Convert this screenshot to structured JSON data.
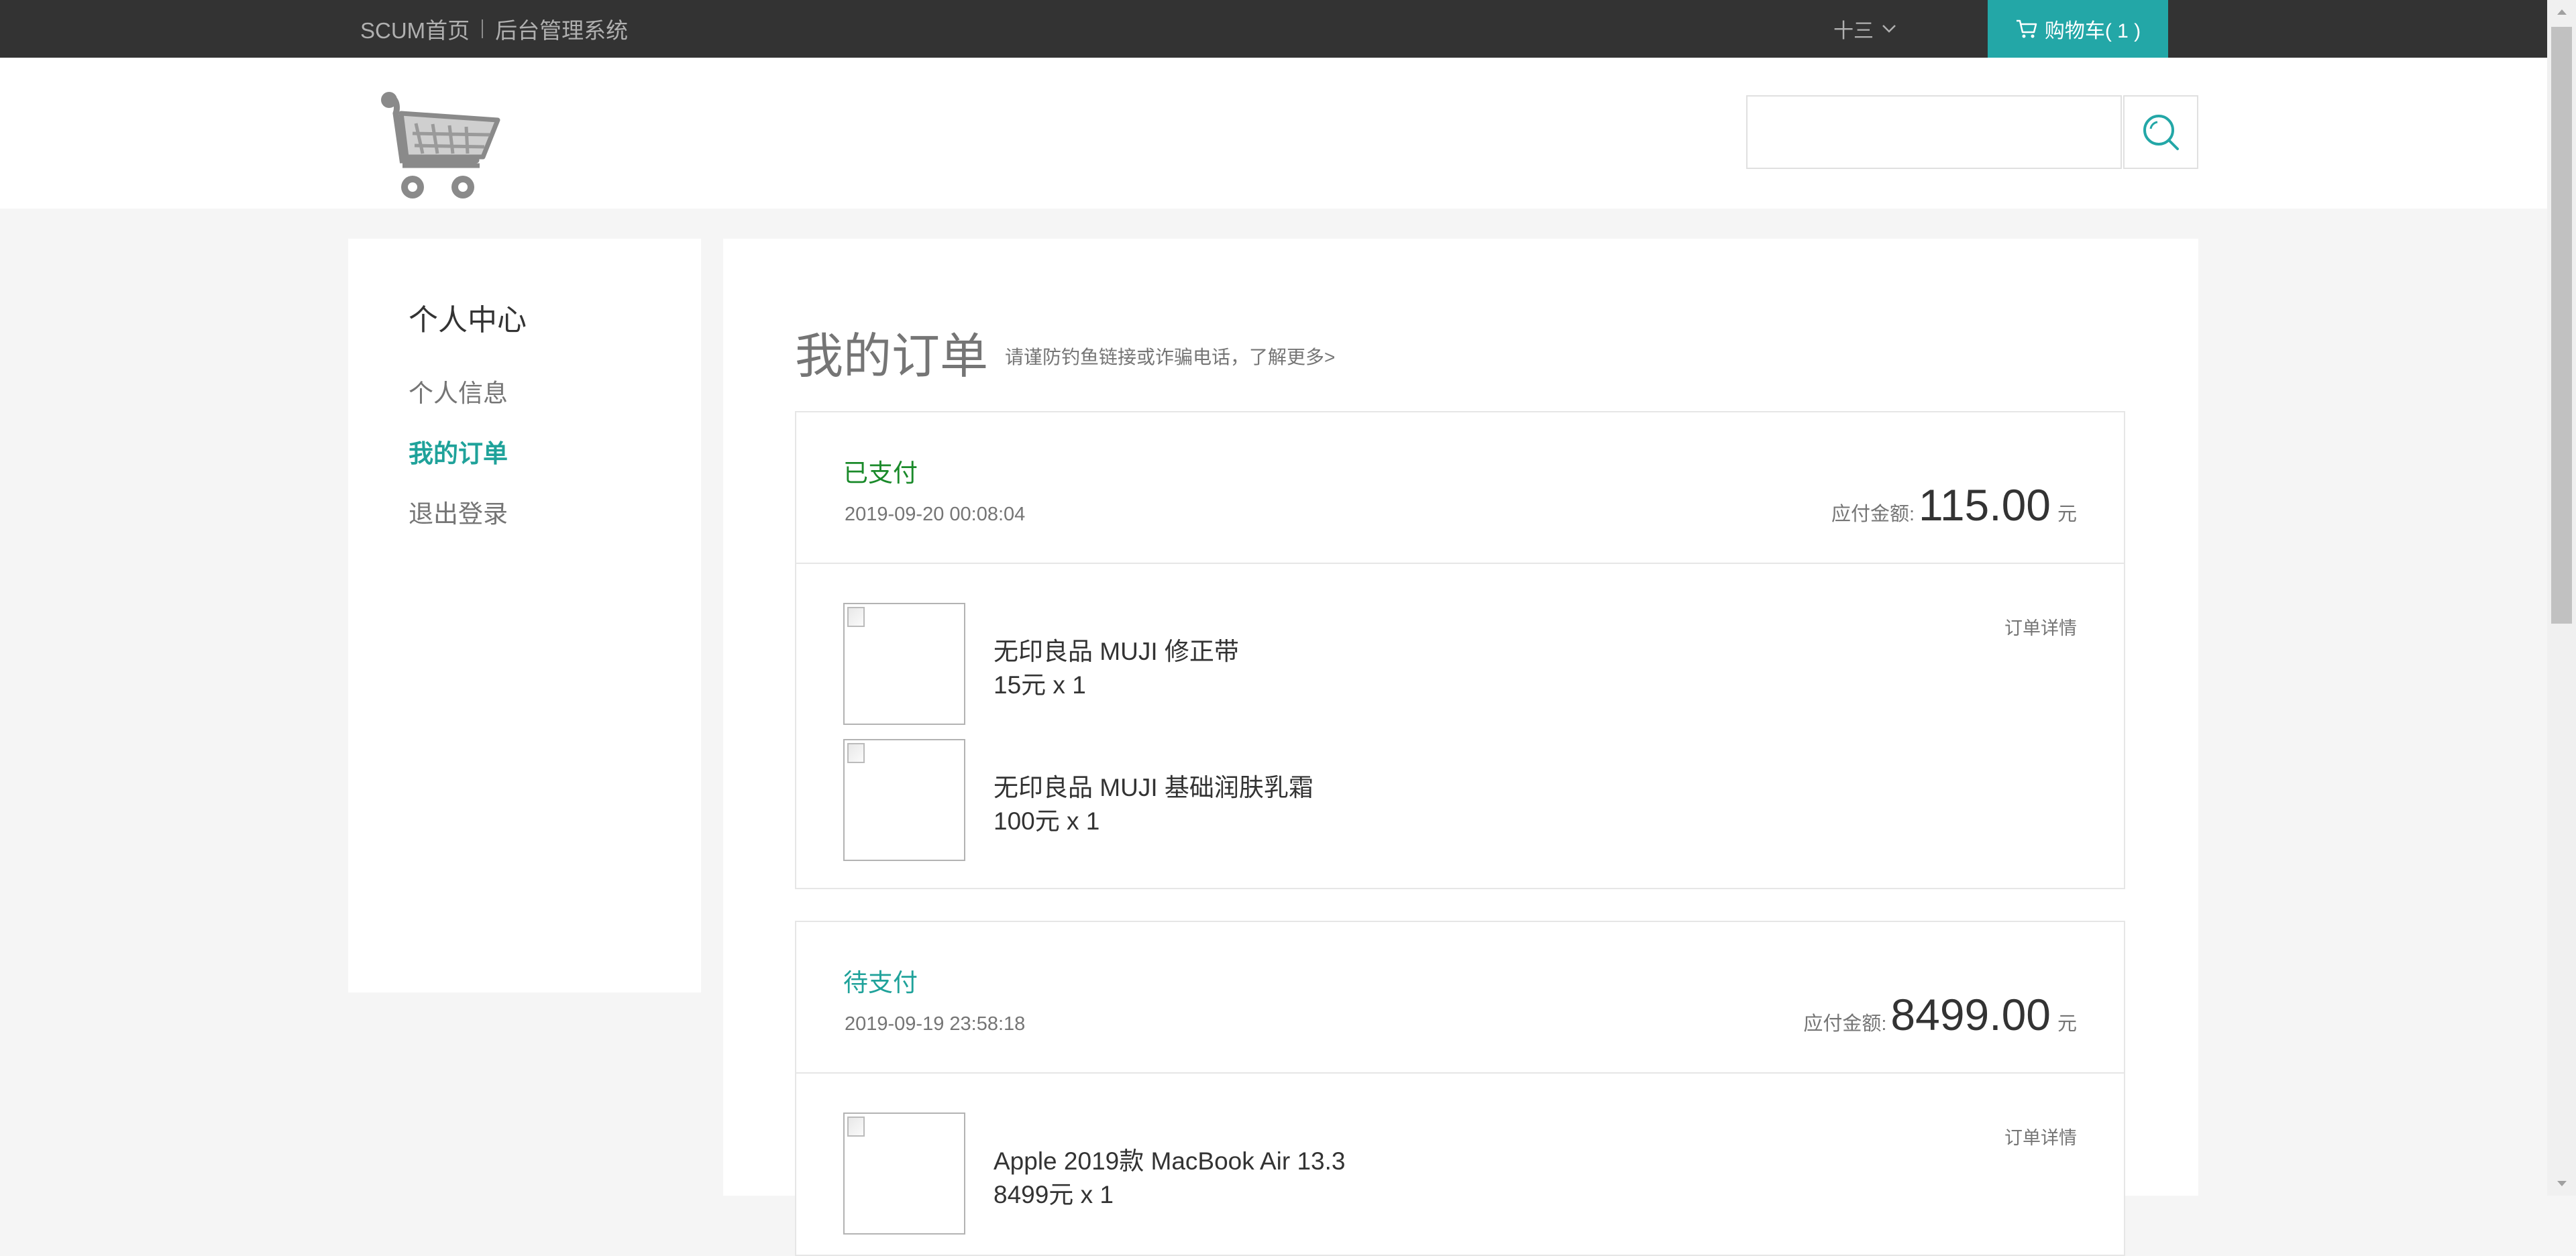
{
  "topbar": {
    "home_link": "SCUM首页",
    "admin_link": "后台管理系统",
    "username": "十三",
    "cart_label": "购物车( 1 )"
  },
  "search": {
    "placeholder": ""
  },
  "sidebar": {
    "title": "个人中心",
    "items": [
      {
        "label": "个人信息",
        "active": false
      },
      {
        "label": "我的订单",
        "active": true
      },
      {
        "label": "退出登录",
        "active": false
      }
    ]
  },
  "main": {
    "title": "我的订单",
    "notice": "请谨防钓鱼链接或诈骗电话，了解更多>",
    "amount_label": "应付金额:",
    "currency_unit": "元",
    "detail_label": "订单详情",
    "orders": [
      {
        "status": "已支付",
        "date": "2019-09-20 00:08:04",
        "amount": "115.00",
        "items": [
          {
            "name": "无印良品 MUJI 修正带",
            "price": "15元 x 1"
          },
          {
            "name": "无印良品 MUJI 基础润肤乳霜",
            "price": "100元 x 1"
          }
        ]
      },
      {
        "status": "待支付",
        "date": "2019-09-19 23:58:18",
        "amount": "8499.00",
        "items": [
          {
            "name": "Apple 2019款 MacBook Air 13.3",
            "price": "8499元 x 1"
          }
        ]
      }
    ]
  },
  "colors": {
    "accent": "#23a7a7",
    "paid": "#1a8a2a",
    "topbar": "#333333"
  }
}
